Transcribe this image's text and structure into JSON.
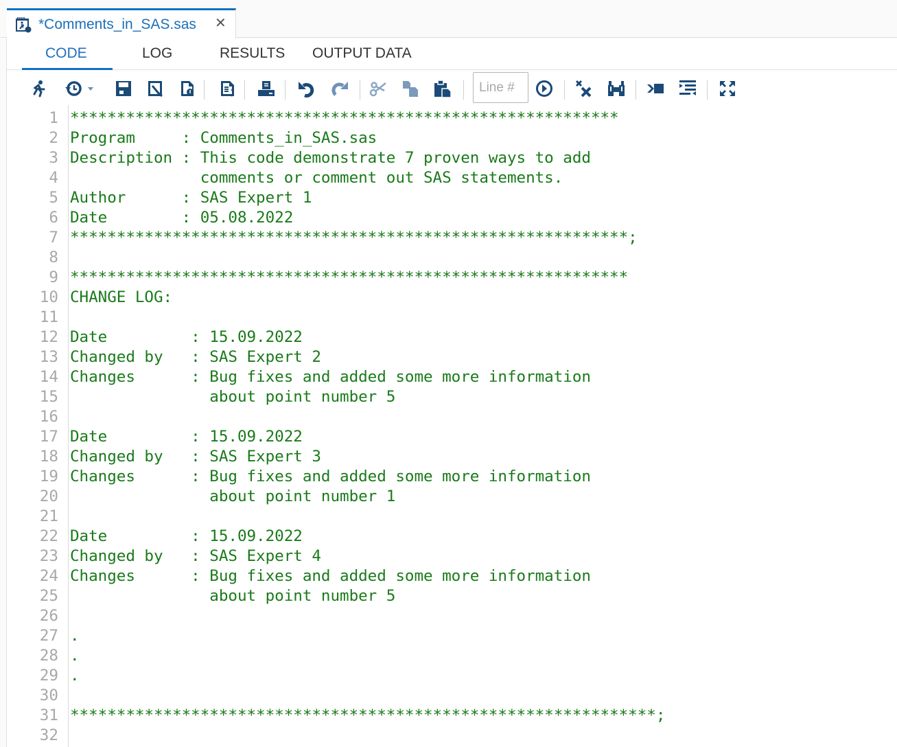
{
  "file_tab": {
    "title": "*Comments_in_SAS.sas",
    "icon": "sas-program-icon",
    "close_label": "✕"
  },
  "view_tabs": [
    {
      "label": "CODE",
      "active": true
    },
    {
      "label": "LOG",
      "active": false
    },
    {
      "label": "RESULTS",
      "active": false
    },
    {
      "label": "OUTPUT DATA",
      "active": false
    }
  ],
  "toolbar": {
    "buttons": [
      "run",
      "history",
      "save",
      "save-as",
      "download",
      "format-code",
      "print",
      "undo",
      "redo",
      "cut",
      "copy",
      "paste",
      "go-to-line",
      "clear",
      "find-replace",
      "submit-selection",
      "snippets",
      "maximize"
    ],
    "line_input_placeholder": "Line #"
  },
  "colors": {
    "accent": "#0f72c4",
    "comment_green": "#1a7a1a",
    "line_number_gray": "#a8a8a8",
    "icon_navy": "#1b4a78"
  },
  "code": {
    "lines": [
      {
        "n": "1",
        "text": "***********************************************************"
      },
      {
        "n": "2",
        "text": "Program     : Comments_in_SAS.sas"
      },
      {
        "n": "3",
        "text": "Description : This code demonstrate 7 proven ways to add"
      },
      {
        "n": "4",
        "text": "              comments or comment out SAS statements."
      },
      {
        "n": "5",
        "text": "Author      : SAS Expert 1"
      },
      {
        "n": "6",
        "text": "Date        : 05.08.2022"
      },
      {
        "n": "7",
        "text": "************************************************************;"
      },
      {
        "n": "8",
        "text": ""
      },
      {
        "n": "9",
        "text": "************************************************************"
      },
      {
        "n": "10",
        "text": "CHANGE LOG:"
      },
      {
        "n": "11",
        "text": ""
      },
      {
        "n": "12",
        "text": "Date         : 15.09.2022"
      },
      {
        "n": "13",
        "text": "Changed by   : SAS Expert 2"
      },
      {
        "n": "14",
        "text": "Changes      : Bug fixes and added some more information"
      },
      {
        "n": "15",
        "text": "               about point number 5"
      },
      {
        "n": "16",
        "text": ""
      },
      {
        "n": "17",
        "text": "Date         : 15.09.2022"
      },
      {
        "n": "18",
        "text": "Changed by   : SAS Expert 3"
      },
      {
        "n": "19",
        "text": "Changes      : Bug fixes and added some more information"
      },
      {
        "n": "20",
        "text": "               about point number 1"
      },
      {
        "n": "21",
        "text": ""
      },
      {
        "n": "22",
        "text": "Date         : 15.09.2022"
      },
      {
        "n": "23",
        "text": "Changed by   : SAS Expert 4"
      },
      {
        "n": "24",
        "text": "Changes      : Bug fixes and added some more information"
      },
      {
        "n": "25",
        "text": "               about point number 5"
      },
      {
        "n": "26",
        "text": ""
      },
      {
        "n": "27",
        "text": "."
      },
      {
        "n": "28",
        "text": "."
      },
      {
        "n": "29",
        "text": "."
      },
      {
        "n": "30",
        "text": ""
      },
      {
        "n": "31",
        "text": "***************************************************************;"
      },
      {
        "n": "32",
        "text": ""
      }
    ]
  }
}
